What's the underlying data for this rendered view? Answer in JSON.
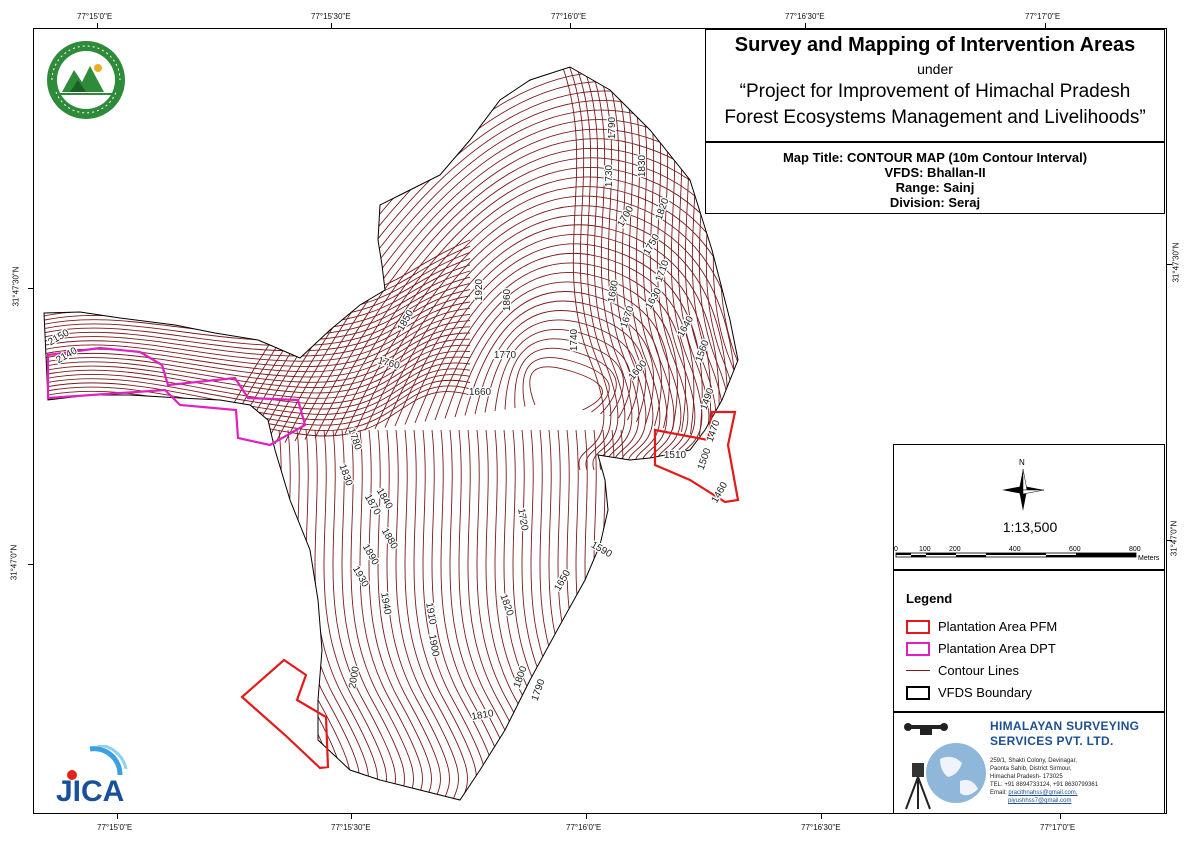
{
  "title": {
    "main": "Survey and Mapping of Intervention Areas",
    "under": "under",
    "project_line1": "“Project for Improvement of Himachal Pradesh",
    "project_line2": "Forest Ecosystems Management and Livelihoods”"
  },
  "info": {
    "map_title": "Map Title: CONTOUR MAP (10m Contour Interval)",
    "vfds": "VFDS: Bhallan-II",
    "range": "Range: Sainj",
    "division": "Division: Seraj"
  },
  "coordinates": {
    "top": [
      "77°15'0\"E",
      "77°15'30\"E",
      "77°16'0\"E",
      "77°16'30\"E",
      "77°17'0\"E"
    ],
    "bottom": [
      "77°15'0\"E",
      "77°15'30\"E",
      "77°16'0\"E",
      "77°16'30\"E",
      "77°17'0\"E"
    ],
    "left": [
      "31°47'30\"N",
      "31°47'0\"N"
    ],
    "right": [
      "31°47'30\"N",
      "31°47'0\"N"
    ]
  },
  "north_arrow": {
    "label": "N",
    "icon": "north-arrow-icon"
  },
  "scale": {
    "ratio": "1:13,500",
    "ticks": [
      "0",
      "100",
      "200",
      "400",
      "600",
      "800"
    ],
    "unit": "Meters"
  },
  "legend": {
    "title": "Legend",
    "items": [
      {
        "label": "Plantation Area PFM",
        "color": "#e41a1a",
        "kind": "polygon"
      },
      {
        "label": "Plantation Area DPT",
        "color": "#e020c0",
        "kind": "polygon"
      },
      {
        "label": "Contour Lines",
        "color": "#7a1a1a",
        "kind": "line"
      },
      {
        "label": "VFDS Boundary",
        "color": "#000000",
        "kind": "polygon"
      }
    ]
  },
  "company": {
    "name_line1": "HIMALAYAN SURVEYING",
    "name_line2": "SERVICES PVT. LTD.",
    "address": [
      "259/1, Shakti Colony, Devinagar,",
      "Paonta Sahib, District Sirmour,",
      "Himachal Pradesh- 173025",
      "TEL: +91 8894733124, +91 8630799361"
    ],
    "email_prefix": "Email:",
    "email1": "pracithnahss@gmail.com,",
    "email2": "piyushhss7@gmail.com"
  },
  "contour_labels": [
    "2150",
    "2140",
    "1850",
    "1920",
    "1860",
    "1760",
    "1770",
    "1660",
    "1740",
    "1790",
    "1830",
    "1730",
    "1820",
    "1700",
    "1750",
    "1710",
    "1680",
    "1670",
    "1630",
    "1640",
    "1560",
    "1600",
    "1490",
    "1470",
    "1510",
    "1500",
    "1460",
    "1780",
    "1830",
    "1840",
    "1870",
    "1880",
    "1890",
    "1930",
    "1720",
    "1590",
    "1940",
    "1910",
    "1900",
    "1650",
    "1820",
    "2000",
    "1800",
    "1790",
    "1810"
  ],
  "colors": {
    "contour": "#7a1a1a",
    "pfm": "#e41a1a",
    "dpt": "#e020c0",
    "boundary": "#000000",
    "company_blue": "#1d4f91"
  }
}
